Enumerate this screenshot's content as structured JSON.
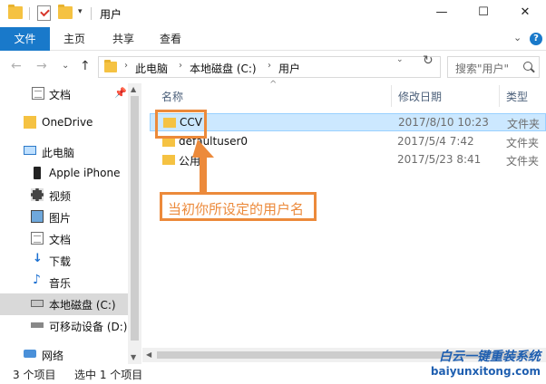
{
  "window": {
    "title": "用户",
    "minimize": "—",
    "maximize": "☐",
    "close": "✕",
    "dropdown_glyph": "▾"
  },
  "ribbon": {
    "tabs": [
      {
        "label": "文件"
      },
      {
        "label": "主页"
      },
      {
        "label": "共享"
      },
      {
        "label": "查看"
      }
    ],
    "expand_glyph": "⌄",
    "help_glyph": "?"
  },
  "address": {
    "back": "←",
    "forward": "→",
    "recent": "⌄",
    "up": "↑",
    "crumbs": [
      "此电脑",
      "本地磁盘 (C:)",
      "用户"
    ],
    "separator": "›",
    "dropdown_glyph": "⌄",
    "refresh_glyph": "↻"
  },
  "search": {
    "placeholder": "搜索\"用户\""
  },
  "nav": {
    "pin_glyph": "📌",
    "items": [
      {
        "label": "文档",
        "icon": "document-icon"
      },
      {
        "label": "OneDrive",
        "icon": "onedrive-icon"
      },
      {
        "label": "此电脑",
        "icon": "computer-icon"
      },
      {
        "label": "Apple iPhone",
        "icon": "phone-icon"
      },
      {
        "label": "视频",
        "icon": "video-icon"
      },
      {
        "label": "图片",
        "icon": "picture-icon"
      },
      {
        "label": "文档",
        "icon": "document-icon"
      },
      {
        "label": "下载",
        "icon": "download-icon"
      },
      {
        "label": "音乐",
        "icon": "music-icon"
      },
      {
        "label": "本地磁盘 (C:)",
        "icon": "drive-icon"
      },
      {
        "label": "可移动设备 (D:)",
        "icon": "usb-drive-icon"
      },
      {
        "label": "网络",
        "icon": "network-icon"
      }
    ],
    "download_glyph": "↓",
    "music_glyph": "♪"
  },
  "columns": {
    "name": "名称",
    "date": "修改日期",
    "type": "类型",
    "sort_glyph": "^"
  },
  "files": [
    {
      "name": "CCV",
      "date": "2017/8/10 10:23",
      "type": "文件夹"
    },
    {
      "name": "defaultuser0",
      "date": "2017/5/4 7:42",
      "type": "文件夹"
    },
    {
      "name": "公用",
      "date": "2017/5/23 8:41",
      "type": "文件夹"
    }
  ],
  "status": {
    "count": "3 个项目",
    "selected": "选中 1 个项目"
  },
  "annotation": {
    "text": "当初你所设定的用户名",
    "color": "#ec8a3b"
  },
  "watermark": {
    "brand": "白云一键重装系统",
    "url": "baiyunxitong.com"
  },
  "colors": {
    "accent": "#1979ca",
    "selection": "#cce8ff",
    "folder": "#f5c242"
  }
}
